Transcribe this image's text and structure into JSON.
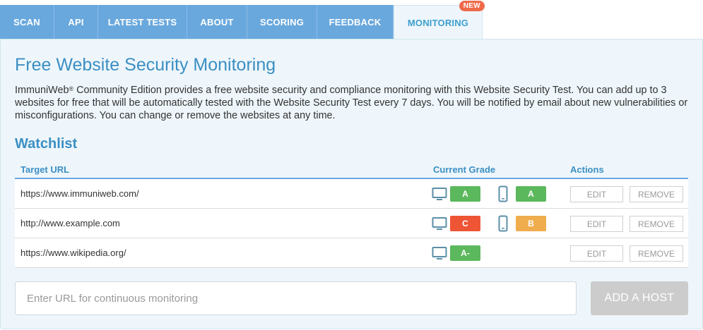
{
  "tabs": [
    {
      "label": "SCAN"
    },
    {
      "label": "API"
    },
    {
      "label": "LATEST TESTS"
    },
    {
      "label": "ABOUT"
    },
    {
      "label": "SCORING"
    },
    {
      "label": "FEEDBACK"
    },
    {
      "label": "MONITORING",
      "badge": "NEW",
      "active": true
    }
  ],
  "main": {
    "title": "Free Website Security Monitoring",
    "desc_brand": "ImmuniWeb",
    "desc_reg": "®",
    "desc_text": " Community Edition provides a free website security and compliance monitoring with this Website Security Test. You can add up to 3 websites for free that will be automatically tested with the Website Security Test every 7 days. You will be notified by email about new vulnerabilities or misconfigurations. You can change or remove the websites at any time.",
    "watchlist_title": "Watchlist"
  },
  "table": {
    "headers": {
      "url": "Target URL",
      "grade": "Current Grade",
      "actions": "Actions"
    },
    "rows": [
      {
        "url": "https://www.immuniweb.com/",
        "desktop_grade": "A",
        "mobile_grade": "A",
        "edit": "EDIT",
        "remove": "REMOVE"
      },
      {
        "url": "http://www.example.com",
        "desktop_grade": "C",
        "mobile_grade": "B",
        "edit": "EDIT",
        "remove": "REMOVE"
      },
      {
        "url": "https://www.wikipedia.org/",
        "desktop_grade": "A-",
        "edit": "EDIT",
        "remove": "REMOVE"
      }
    ]
  },
  "colors": {
    "grade_A": "#5cb85c",
    "grade_C": "#ee5535",
    "grade_B": "#f0ad4e",
    "accent": "#3b8fc3",
    "tab_bg": "#69a8dd",
    "badge": "#ef6a4a"
  },
  "icons": {
    "desktop": "monitor-icon",
    "mobile": "smartphone-icon"
  },
  "host": {
    "placeholder": "Enter URL for continuous monitoring",
    "button": "ADD A HOST"
  }
}
